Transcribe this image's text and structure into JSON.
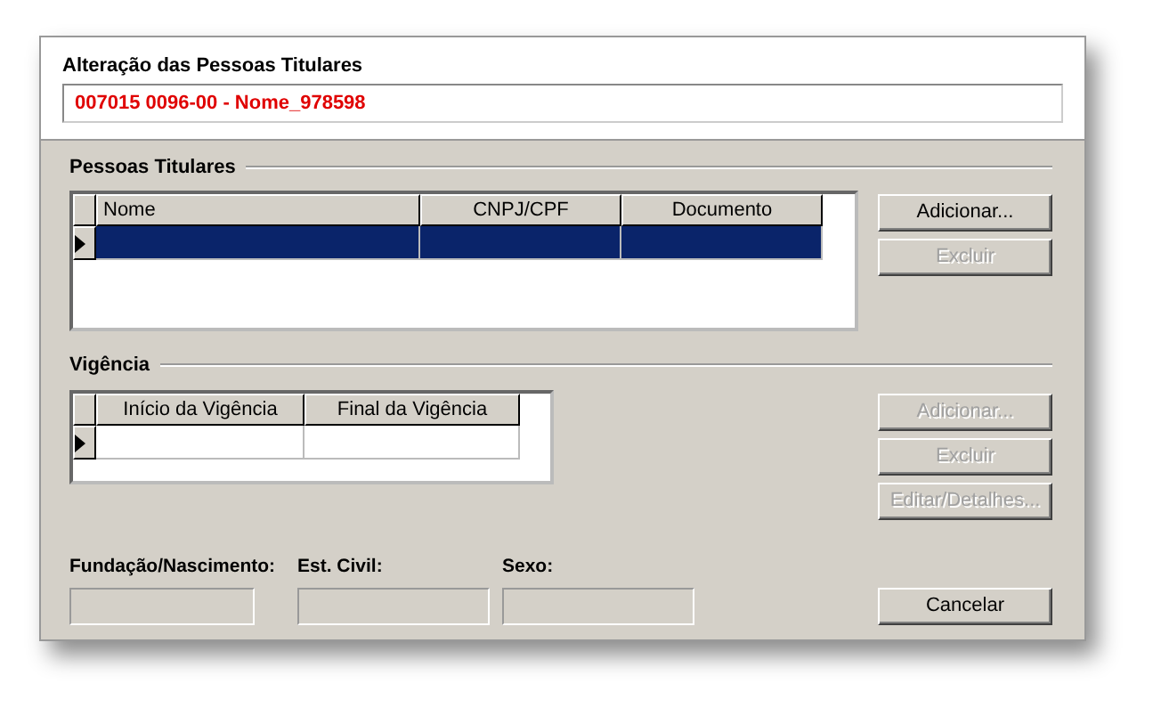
{
  "window": {
    "title": "Alteração das Pessoas Titulares",
    "record": "007015 0096-00 - Nome_978598"
  },
  "sections": [
    {
      "title": "Pessoas Titulares",
      "columns": [
        {
          "label": "Nome"
        },
        {
          "label": "CNPJ/CPF"
        },
        {
          "label": "Documento"
        }
      ],
      "rows": [
        {
          "current": true,
          "selected": true
        }
      ],
      "buttons": [
        {
          "label": "Adicionar...",
          "disabled": false
        },
        {
          "label": "Excluir",
          "disabled": true
        }
      ]
    },
    {
      "title": "Vigência",
      "columns": [
        {
          "label": "Início da Vigência"
        },
        {
          "label": "Final da Vigência"
        }
      ],
      "rows": [
        {
          "current": true,
          "selected": false
        }
      ],
      "buttons": [
        {
          "label": "Adicionar...",
          "disabled": true
        },
        {
          "label": "Excluir",
          "disabled": true
        },
        {
          "label": "Editar/Detalhes...",
          "disabled": true
        }
      ]
    }
  ],
  "fields": [
    {
      "label": "Fundação/Nascimento:"
    },
    {
      "label": "Est. Civil:"
    },
    {
      "label": "Sexo:"
    }
  ],
  "buttons": [
    {
      "label": "Cancelar",
      "disabled": false
    }
  ]
}
